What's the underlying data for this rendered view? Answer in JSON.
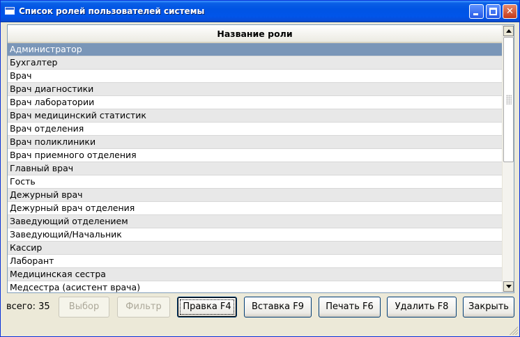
{
  "window": {
    "title": "Список ролей пользователей системы",
    "controls": {
      "minimize": "minimize-icon",
      "maximize": "maximize-icon",
      "close": "close-icon"
    }
  },
  "grid": {
    "column_header": "Название роли",
    "selected_index": 0,
    "rows": [
      "Администратор",
      "Бухгалтер",
      "Врач",
      "Врач диагностики",
      "Врач лаборатории",
      "Врач медицинский статистик",
      "Врач отделения",
      "Врач поликлиники",
      "Врач приемного отделения",
      "Главный врач",
      "Гость",
      "Дежурный врач",
      "Дежурный врач отделения",
      "Заведующий отделением",
      "Заведующий/Начальник",
      "Кассир",
      "Лаборант",
      "Медицинская сестра",
      "Медсестра (асистент врача)"
    ]
  },
  "footer": {
    "total_label": "всего: 35",
    "buttons": {
      "select": "Выбор",
      "filter": "Фильтр",
      "edit": "Правка F4",
      "insert": "Вставка F9",
      "print": "Печать F6",
      "delete": "Удалить F8",
      "close": "Закрыть"
    }
  },
  "colors": {
    "titlebar": "#0054e3",
    "selected_row": "#7a96b8",
    "odd_row": "#e8e8e8",
    "window_bg": "#ece9d8"
  }
}
